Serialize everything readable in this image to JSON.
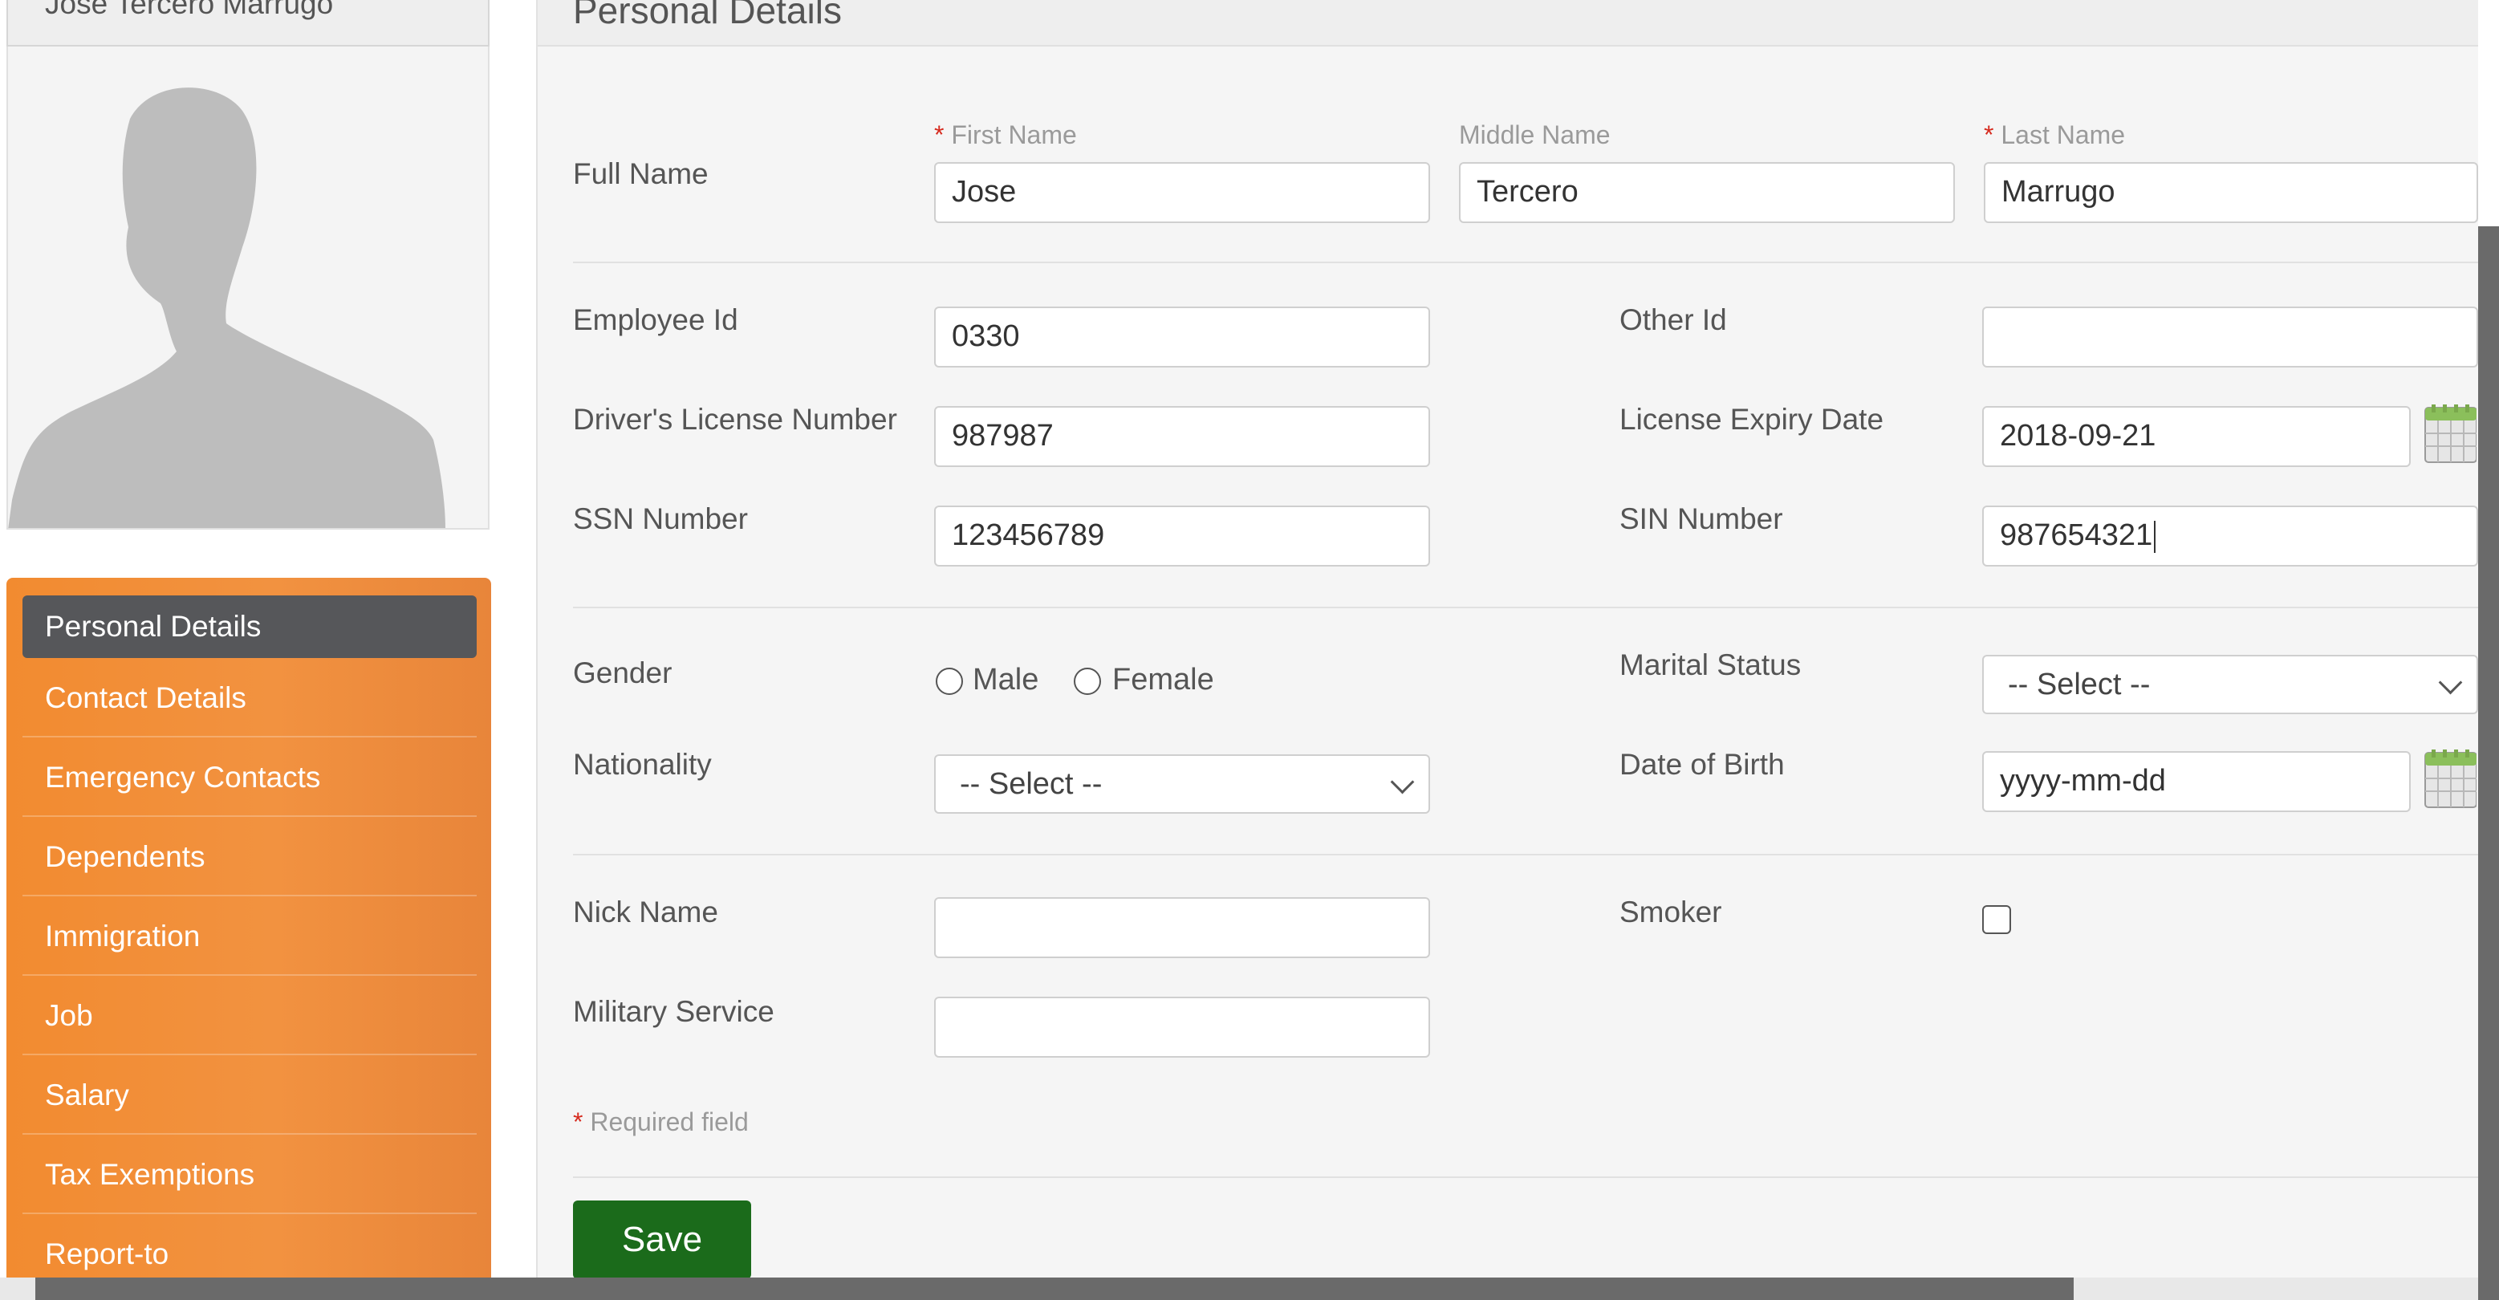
{
  "employee": {
    "name": "Jose Tercero Marrugo"
  },
  "sidebar": {
    "active": "Personal Details",
    "items": [
      "Contact Details",
      "Emergency Contacts",
      "Dependents",
      "Immigration",
      "Job",
      "Salary",
      "Tax Exemptions",
      "Report-to"
    ]
  },
  "panel": {
    "title": "Personal Details",
    "full_name": {
      "label": "Full Name",
      "first": {
        "label": "First Name",
        "value": "Jose",
        "required": "*"
      },
      "middle": {
        "label": "Middle Name",
        "value": "Tercero"
      },
      "last": {
        "label": "Last Name",
        "value": "Marrugo",
        "required": "*"
      }
    },
    "employee_id": {
      "label": "Employee Id",
      "value": "0330"
    },
    "other_id": {
      "label": "Other Id",
      "value": ""
    },
    "drivers_license": {
      "label": "Driver's License Number",
      "value": "987987"
    },
    "license_expiry": {
      "label": "License Expiry Date",
      "value": "2018-09-21"
    },
    "ssn": {
      "label": "SSN Number",
      "value": "123456789"
    },
    "sin": {
      "label": "SIN Number",
      "value": "987654321"
    },
    "gender": {
      "label": "Gender",
      "options": [
        "Male",
        "Female"
      ]
    },
    "marital_status": {
      "label": "Marital Status",
      "selected": "-- Select --"
    },
    "nationality": {
      "label": "Nationality",
      "selected": "-- Select --"
    },
    "dob": {
      "label": "Date of Birth",
      "value": "yyyy-mm-dd"
    },
    "nick_name": {
      "label": "Nick Name",
      "value": ""
    },
    "smoker": {
      "label": "Smoker"
    },
    "military_service": {
      "label": "Military Service",
      "value": ""
    },
    "required_note": {
      "star": "*",
      "text": "Required field"
    },
    "save_label": "Save"
  },
  "colors": {
    "sidebar_orange": "#f28b30",
    "active_item": "#56575a",
    "save_green": "#1b6b1b",
    "required_red": "#d62b1f"
  }
}
